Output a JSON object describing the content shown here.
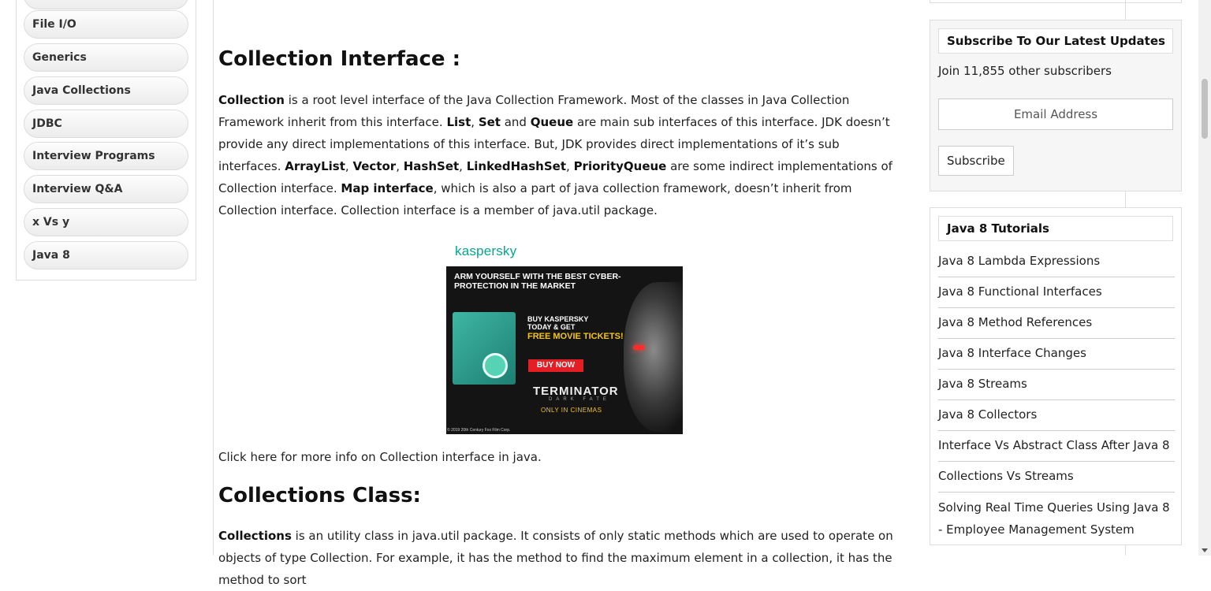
{
  "left_menu": {
    "items": [
      "File I/O",
      "Generics",
      "Java Collections",
      "JDBC",
      "Interview Programs",
      "Interview Q&A",
      "x Vs y",
      "Java 8"
    ]
  },
  "content": {
    "heading1": "Collection Interface :",
    "para1_html": "<b>Collection</b> is a root level interface of the Java Collection Framework. Most of the classes in Java Collection Framework inherit from this interface. <b>List</b>, <b>Set</b> and <b>Queue</b> are main sub interfaces of this interface. JDK doesn’t provide any direct implementations of this interface. But, JDK provides direct implementations of it’s sub interfaces. <b>ArrayList</b>, <b>Vector</b>, <b>HashSet</b>, <b>LinkedHashSet</b>, <b>PriorityQueue</b> are some indirect implementations of Collection interface. <b>Map interface</b>, which is also a part of java collection framework, doesn’t inherit from Collection interface. Collection interface is a member of java.util package.",
    "more_info": "Click here for more info on Collection interface in java.",
    "heading2": "Collections Class:",
    "para2_html": "<b>Collections</b> is an utility class in java.util package. It consists of only static methods which are used to operate on objects of type Collection. For example, it has the method to find the maximum element in a collection, it has the method to sort"
  },
  "ad": {
    "brand": "kaspersky",
    "headline": "ARM YOURSELF WITH THE BEST CYBER-PROTECTION IN THE MARKET",
    "offer": "BUY KASPERSKY TODAY & GET",
    "offer_highlight": "FREE MOVIE TICKETS!",
    "button": "BUY NOW",
    "movie": "TERMINATOR",
    "movie_sub": "DARK FATE",
    "tagline": "ONLY IN CINEMAS",
    "copyright": "© 2019 20th Century Fox Film Corp."
  },
  "subscribe": {
    "title": "Subscribe To Our Latest Updates",
    "count_text": "Join 11,855 other subscribers",
    "email_placeholder": "Email Address",
    "button": "Subscribe"
  },
  "java8": {
    "title": "Java 8 Tutorials",
    "items": [
      "Java 8 Lambda Expressions",
      "Java 8 Functional Interfaces",
      "Java 8 Method References",
      "Java 8 Interface Changes",
      "Java 8 Streams",
      "Java 8 Collectors",
      "Interface Vs Abstract Class After Java 8",
      "Collections Vs Streams",
      "Solving Real Time Queries Using Java 8 - Employee Management System"
    ]
  }
}
